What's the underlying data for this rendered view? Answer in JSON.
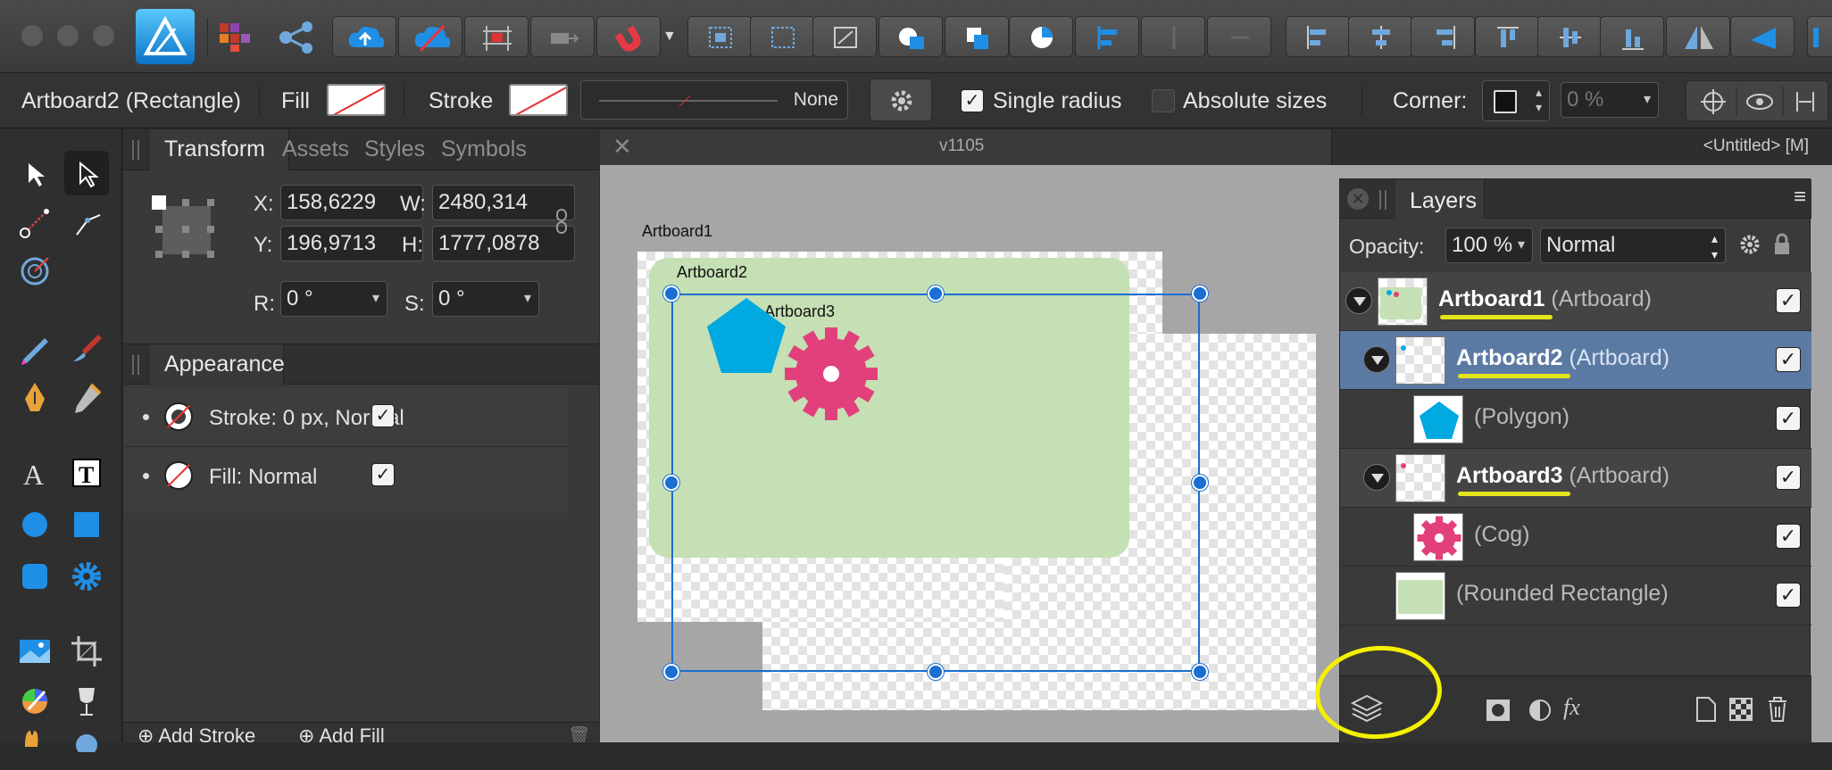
{
  "app": {
    "traffic_lights": [
      "close",
      "minimize",
      "zoom"
    ]
  },
  "context": {
    "selection_label": "Artboard2 (Rectangle)",
    "fill_label": "Fill",
    "stroke_label": "Stroke",
    "stroke_style": "None",
    "single_radius_label": "Single radius",
    "single_radius_checked": true,
    "absolute_sizes_label": "Absolute sizes",
    "absolute_sizes_checked": false,
    "corner_label": "Corner:",
    "corner_value": "0 %"
  },
  "studio": {
    "tabs": [
      "Transform",
      "Assets",
      "Styles",
      "Symbols"
    ],
    "active_tab": "Transform",
    "transform": {
      "x_label": "X:",
      "x": "158,6229",
      "y_label": "Y:",
      "y": "196,9713",
      "w_label": "W:",
      "w": "2480,314",
      "h_label": "H:",
      "h": "1777,0878",
      "r_label": "R:",
      "r": "0 °",
      "s_label": "S:",
      "s": "0 °"
    },
    "appearance_tab": "Appearance",
    "appearance_items": [
      {
        "label": "Stroke: 0 px, Normal",
        "checked": true
      },
      {
        "label": "Fill: Normal",
        "checked": true
      }
    ],
    "add_stroke": "Add Stroke",
    "add_fill": "Add Fill"
  },
  "document": {
    "version": "v1105",
    "title": "<Untitled> [M]"
  },
  "canvas": {
    "artboard_labels": [
      "Artboard1",
      "Artboard2",
      "Artboard3"
    ]
  },
  "layers": {
    "title": "Layers",
    "opacity_label": "Opacity:",
    "opacity_value": "100 %",
    "blend_mode": "Normal",
    "rows": [
      {
        "name": "Artboard1",
        "kind": "(Artboard)",
        "bold": true,
        "visible": true
      },
      {
        "name": "Artboard2",
        "kind": "(Artboard)",
        "bold": true,
        "visible": true,
        "selected": true
      },
      {
        "name": "",
        "kind": "(Polygon)",
        "bold": false,
        "visible": true
      },
      {
        "name": "Artboard3",
        "kind": "(Artboard)",
        "bold": true,
        "visible": true
      },
      {
        "name": "",
        "kind": "(Cog)",
        "bold": false,
        "visible": true
      },
      {
        "name": "",
        "kind": "(Rounded Rectangle)",
        "bold": false,
        "visible": true
      }
    ]
  },
  "colors": {
    "accent": "#1a6fd0",
    "polygon": "#00a9e0",
    "cog": "#e2407c",
    "rounded_rect": "#c5e0b4",
    "highlight": "#f4f000",
    "selected_row": "#5b7aa3"
  }
}
